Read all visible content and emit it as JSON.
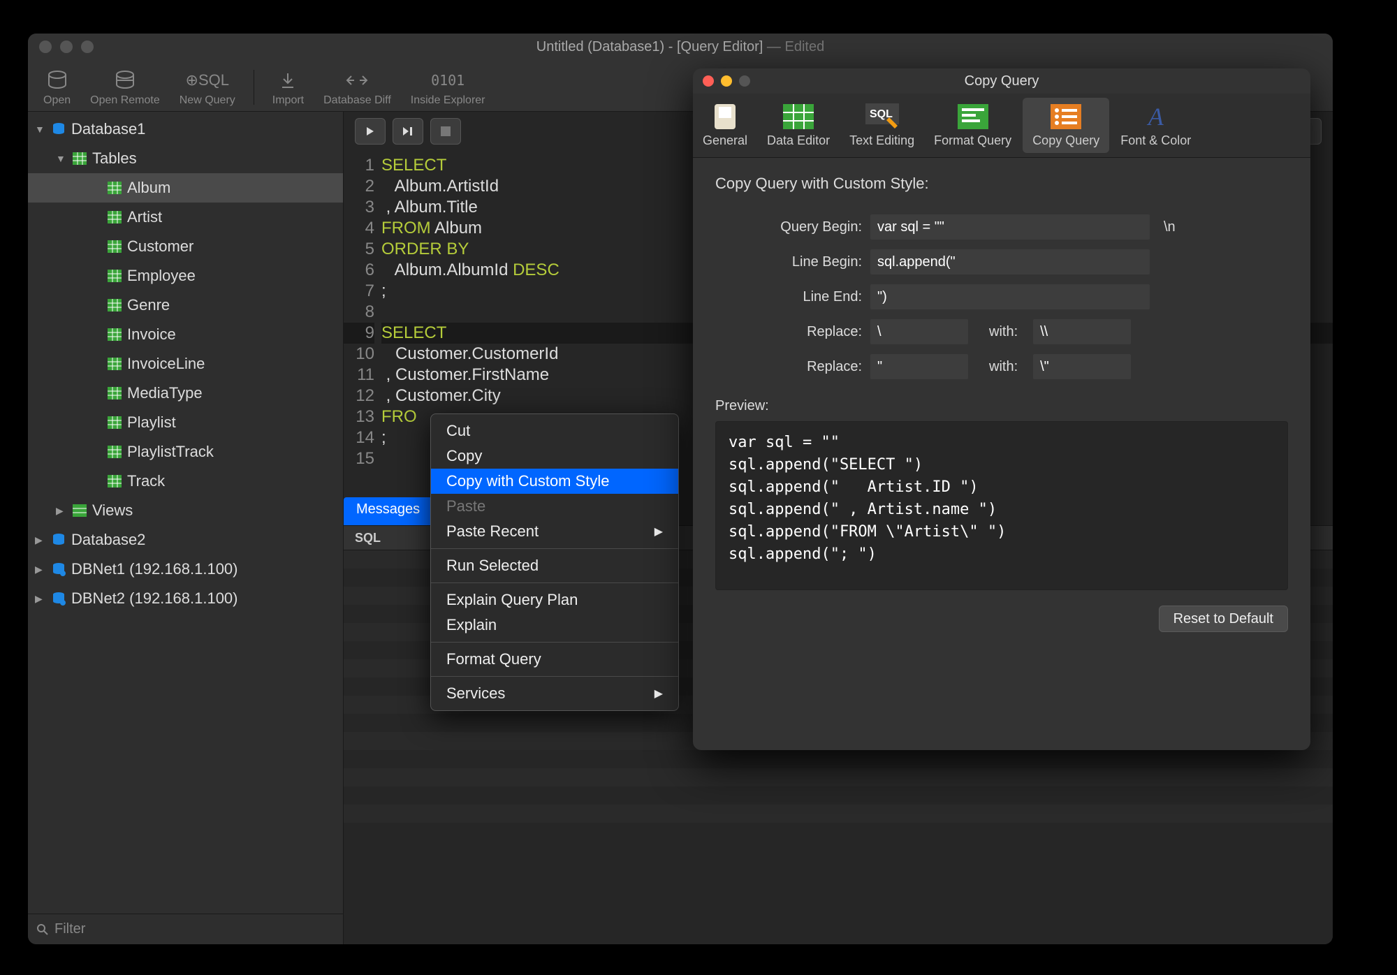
{
  "window": {
    "title_main": "Untitled (Database1) - [Query Editor]",
    "title_suffix": " — Edited"
  },
  "toolbar": {
    "open": "Open",
    "open_remote": "Open Remote",
    "new_query": "New Query",
    "new_query_icon_text": "⊕SQL",
    "import": "Import",
    "db_diff": "Database Diff",
    "inside_explorer": "Inside Explorer",
    "inside_explorer_icon_text": "0101"
  },
  "sidebar": {
    "db1": "Database1",
    "tables": "Tables",
    "items": [
      {
        "label": "Album"
      },
      {
        "label": "Artist"
      },
      {
        "label": "Customer"
      },
      {
        "label": "Employee"
      },
      {
        "label": "Genre"
      },
      {
        "label": "Invoice"
      },
      {
        "label": "InvoiceLine"
      },
      {
        "label": "MediaType"
      },
      {
        "label": "Playlist"
      },
      {
        "label": "PlaylistTrack"
      },
      {
        "label": "Track"
      }
    ],
    "views": "Views",
    "db2": "Database2",
    "dbnet1": "DBNet1 (192.168.1.100)",
    "dbnet2": "DBNet2 (192.168.1.100)",
    "filter_placeholder": "Filter"
  },
  "editor": {
    "explain_btn": "Explain Query Plan",
    "lines": [
      {
        "n": "1",
        "html": "<span class='kw'>SELECT</span>"
      },
      {
        "n": "2",
        "html": "   Album.ArtistId"
      },
      {
        "n": "3",
        "html": " , Album.Title"
      },
      {
        "n": "4",
        "html": "<span class='kw'>FROM</span> Album"
      },
      {
        "n": "5",
        "html": "<span class='kw'>ORDER BY</span>"
      },
      {
        "n": "6",
        "html": "   Album.AlbumId <span class='kw'>DESC</span>"
      },
      {
        "n": "7",
        "html": ";"
      },
      {
        "n": "8",
        "html": ""
      },
      {
        "n": "9",
        "html": "<span class='kw'>SELECT</span>",
        "hl": true
      },
      {
        "n": "10",
        "html": "   Customer.CustomerId"
      },
      {
        "n": "11",
        "html": " , Customer.FirstName"
      },
      {
        "n": "12",
        "html": " , Customer.City"
      },
      {
        "n": "13",
        "html": "<span class='kw'>FRO</span>"
      },
      {
        "n": "14",
        "html": ";"
      },
      {
        "n": "15",
        "html": ""
      }
    ],
    "messages_tab": "Messages",
    "sql_header": "SQL"
  },
  "context_menu": {
    "cut": "Cut",
    "copy": "Copy",
    "copy_custom": "Copy with Custom Style",
    "paste": "Paste",
    "paste_recent": "Paste Recent",
    "run_selected": "Run Selected",
    "explain_qp": "Explain Query Plan",
    "explain": "Explain",
    "format_query": "Format Query",
    "services": "Services"
  },
  "prefs": {
    "title": "Copy Query",
    "tabs": {
      "general": "General",
      "data_editor": "Data Editor",
      "text_editing": "Text Editing",
      "format_query": "Format Query",
      "copy_query": "Copy Query",
      "font_color": "Font & Color"
    },
    "heading": "Copy Query with Custom Style:",
    "labels": {
      "query_begin": "Query Begin:",
      "line_begin": "Line Begin:",
      "line_end": "Line End:",
      "replace": "Replace:",
      "with": "with:"
    },
    "values": {
      "query_begin": "var sql = \"\"",
      "query_begin_tail": "\\n",
      "line_begin": "sql.append(\"",
      "line_end": "\")",
      "replace1_from": "\\",
      "replace1_to": "\\\\",
      "replace2_from": "\"",
      "replace2_to": "\\\""
    },
    "preview_label": "Preview:",
    "preview": "var sql = \"\"\nsql.append(\"SELECT \")\nsql.append(\"   Artist.ID \")\nsql.append(\" , Artist.name \")\nsql.append(\"FROM \\\"Artist\\\" \")\nsql.append(\"; \")",
    "reset": "Reset to Default"
  }
}
